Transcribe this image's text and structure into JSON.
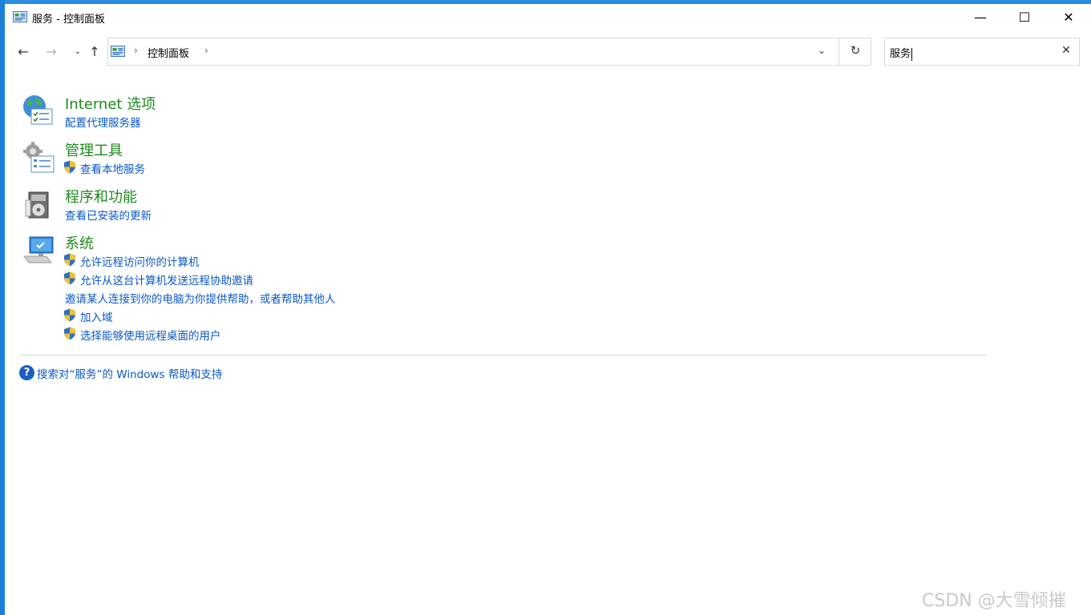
{
  "window": {
    "title": "服务 - 控制面板",
    "minimize_label": "—",
    "maximize_label": "☐",
    "close_label": "✕"
  },
  "navigation": {
    "back_glyph": "←",
    "forward_glyph": "→",
    "recent_glyph": "⌄",
    "up_glyph": "↑",
    "breadcrumb_separator": "›",
    "breadcrumb": "控制面板",
    "dropdown_glyph": "⌄",
    "refresh_glyph": "↻"
  },
  "search": {
    "value": "服务",
    "clear_glyph": "✕"
  },
  "results": [
    {
      "title": "Internet 选项",
      "icon": "internet-options-icon",
      "links": [
        {
          "label": "配置代理服务器",
          "shield": false
        }
      ]
    },
    {
      "title": "管理工具",
      "icon": "admin-tools-icon",
      "links": [
        {
          "label": "查看本地服务",
          "shield": true
        }
      ]
    },
    {
      "title": "程序和功能",
      "icon": "programs-features-icon",
      "links": [
        {
          "label": "查看已安装的更新",
          "shield": false
        }
      ]
    },
    {
      "title": "系统",
      "icon": "system-icon",
      "links": [
        {
          "label": "允许远程访问你的计算机",
          "shield": true
        },
        {
          "label": "允许从这台计算机发送远程协助邀请",
          "shield": true
        },
        {
          "label": "邀请某人连接到你的电脑为你提供帮助，或者帮助其他人",
          "shield": false
        },
        {
          "label": "加入域",
          "shield": true
        },
        {
          "label": "选择能够使用远程桌面的用户",
          "shield": true
        }
      ]
    }
  ],
  "help": {
    "glyph": "?",
    "label": "搜索对“服务”的 Windows 帮助和支持"
  },
  "watermark": "CSDN @大雪倾摧",
  "colors": {
    "category_title": "#1e8a1e",
    "link": "#0a58c6",
    "frame_accent": "#1d7fd6"
  }
}
